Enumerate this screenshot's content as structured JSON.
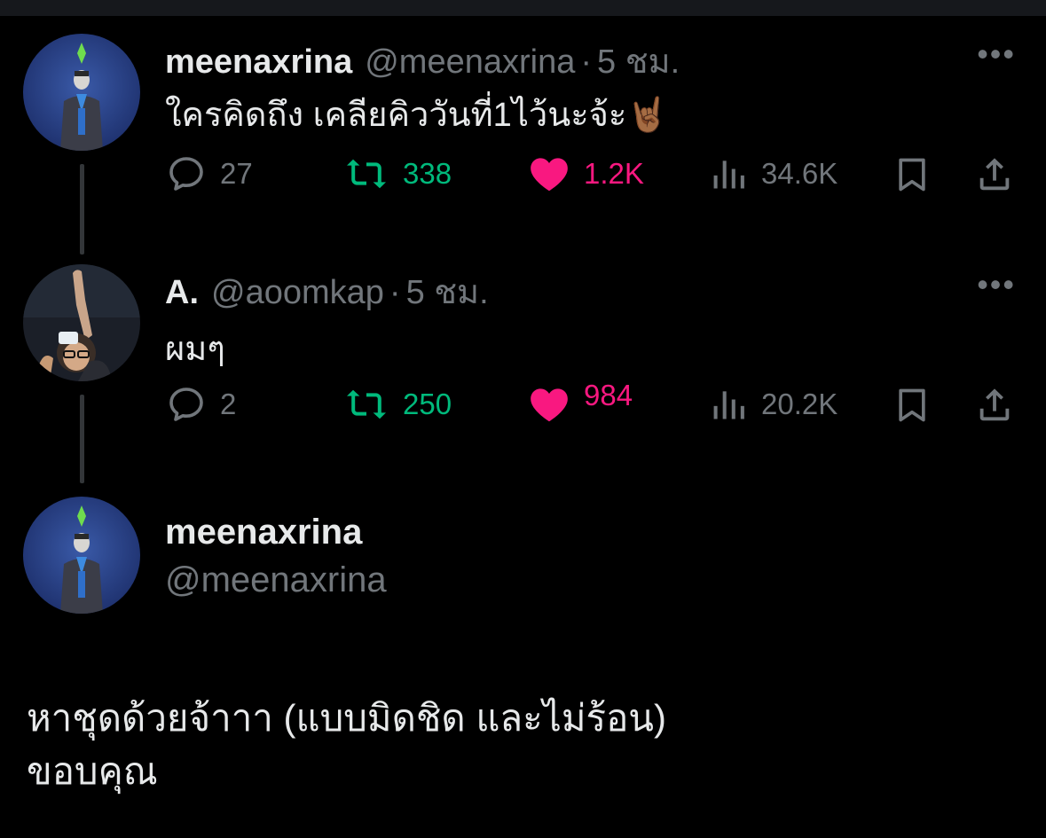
{
  "tweets": [
    {
      "name": "meenaxrina",
      "handle": "@meenaxrina",
      "dot": "·",
      "time": "5 ชม.",
      "text": "ใครคิดถึง เคลียคิววันที่1ไว้นะจ้ะ",
      "emoji": "🤘🏾",
      "replies": "27",
      "retweets": "338",
      "likes": "1.2K",
      "views": "34.6K",
      "more": "•••"
    },
    {
      "name": "A.",
      "handle": "@aoomkap",
      "dot": "·",
      "time": "5 ชม.",
      "text": "ผมๆ",
      "replies": "2",
      "retweets": "250",
      "likes": "984",
      "views": "20.2K",
      "more": "•••"
    }
  ],
  "main_tweet": {
    "name": "meenaxrina",
    "handle": "@meenaxrina",
    "text_line1": "หาชุดด้วยจ้าาา (แบบมิดชิด และไม่ร้อน)",
    "text_line2": "ขอบคุณ"
  },
  "colors": {
    "background": "#000000",
    "muted": "#71767b",
    "retweet": "#00ba7c",
    "like": "#f91880",
    "thread_line": "#333639"
  },
  "icons": [
    "reply-icon",
    "retweet-icon",
    "heart-icon",
    "views-icon",
    "bookmark-icon",
    "share-icon",
    "more-icon"
  ]
}
